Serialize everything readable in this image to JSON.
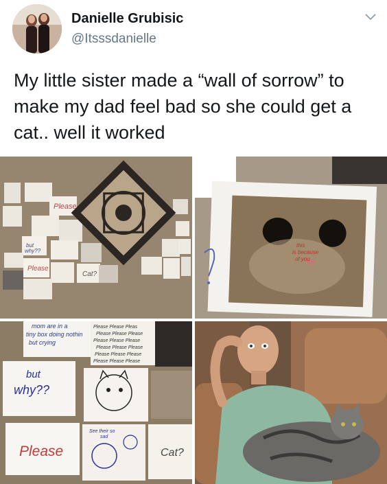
{
  "author": {
    "name": "Danielle Grubisic",
    "handle": "@Itsssdanielle"
  },
  "tweet": {
    "text": "My little sister made a “wall of sorrow” to make my dad feel bad so she could get a cat.. well it worked"
  },
  "photos": {
    "p1": {
      "please": "Please",
      "why": "but why??",
      "please2": "Please",
      "cat": "Cat?"
    },
    "p2": {
      "note_line1": "this",
      "note_line2": "is because",
      "note_line3": "of you"
    },
    "p3": {
      "note_top1": "mom are in a",
      "note_top2": "tiny box doing nothin",
      "note_top3": "but crying",
      "please_line1": "Please Please Pleas",
      "please_line2": "Please Please Please",
      "please_line3": "Please Please Please",
      "please_line4": "Please Please Please",
      "please_line5": "Please Please Please",
      "please_line6": "Please Please Please",
      "but": "but",
      "why": "why??",
      "please": "Please",
      "cat": "Cat?",
      "see_their": "See their so",
      "sad": "sad"
    }
  },
  "icons": {
    "chevron": "chevron-down-icon"
  }
}
